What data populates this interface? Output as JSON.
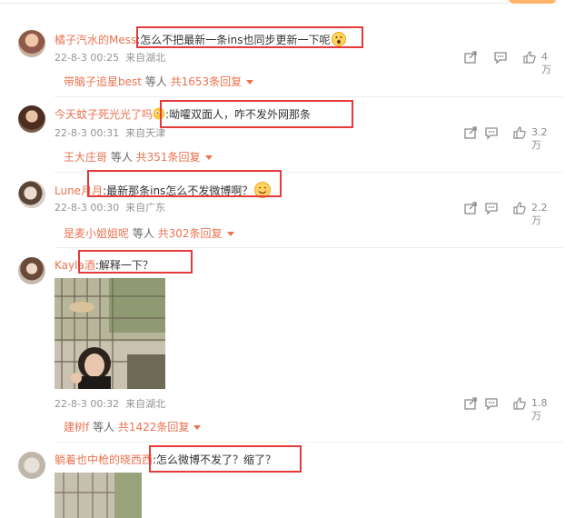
{
  "comments": [
    {
      "username": "橘子汽水的Mess",
      "text": ":怎么不把最新一条ins也同步更新一下呢",
      "time": "22-8-3 00:25",
      "location": "来自湖北",
      "likes": "4万",
      "reply_user": "带脑子追星best",
      "reply_mid": " 等人 ",
      "reply_link": "共1653条回复",
      "emoji": "surprised-emoji"
    },
    {
      "username": "今天蚊子死光光了吗",
      "text": ":呦嚯双面人，咋不发外网那条",
      "time": "22-8-3 00:31",
      "location": "来自天津",
      "likes": "3.2万",
      "reply_user": "王大庄哥",
      "reply_mid": " 等人 ",
      "reply_link": "共351条回复",
      "emoji": "eyes-emoji"
    },
    {
      "username": "Lune月月",
      "text": ":最新那条ins怎么不发微博啊？",
      "time": "22-8-3 00:30",
      "location": "来自广东",
      "likes": "2.2万",
      "reply_user": "是麦小姐姐呢",
      "reply_mid": " 等人 ",
      "reply_link": "共302条回复",
      "emoji": "smile-emoji"
    },
    {
      "username": "Kayla酒",
      "text": ":解释一下？",
      "time": "22-8-3 00:32",
      "location": "来自湖北",
      "likes": "1.8万",
      "reply_user": "建树f",
      "reply_mid": " 等人 ",
      "reply_link": "共1422条回复"
    },
    {
      "username": "躺着也中枪的晓西西",
      "text": ":怎么微博不发了？缩了？"
    }
  ],
  "icons": {
    "share": "share-icon",
    "comment": "comment-icon",
    "like": "thumbs-up-icon",
    "expand": "caret-down-icon"
  },
  "colors": {
    "username": "#eb7350",
    "highlight": "#e63a3a",
    "meta": "#939393"
  }
}
